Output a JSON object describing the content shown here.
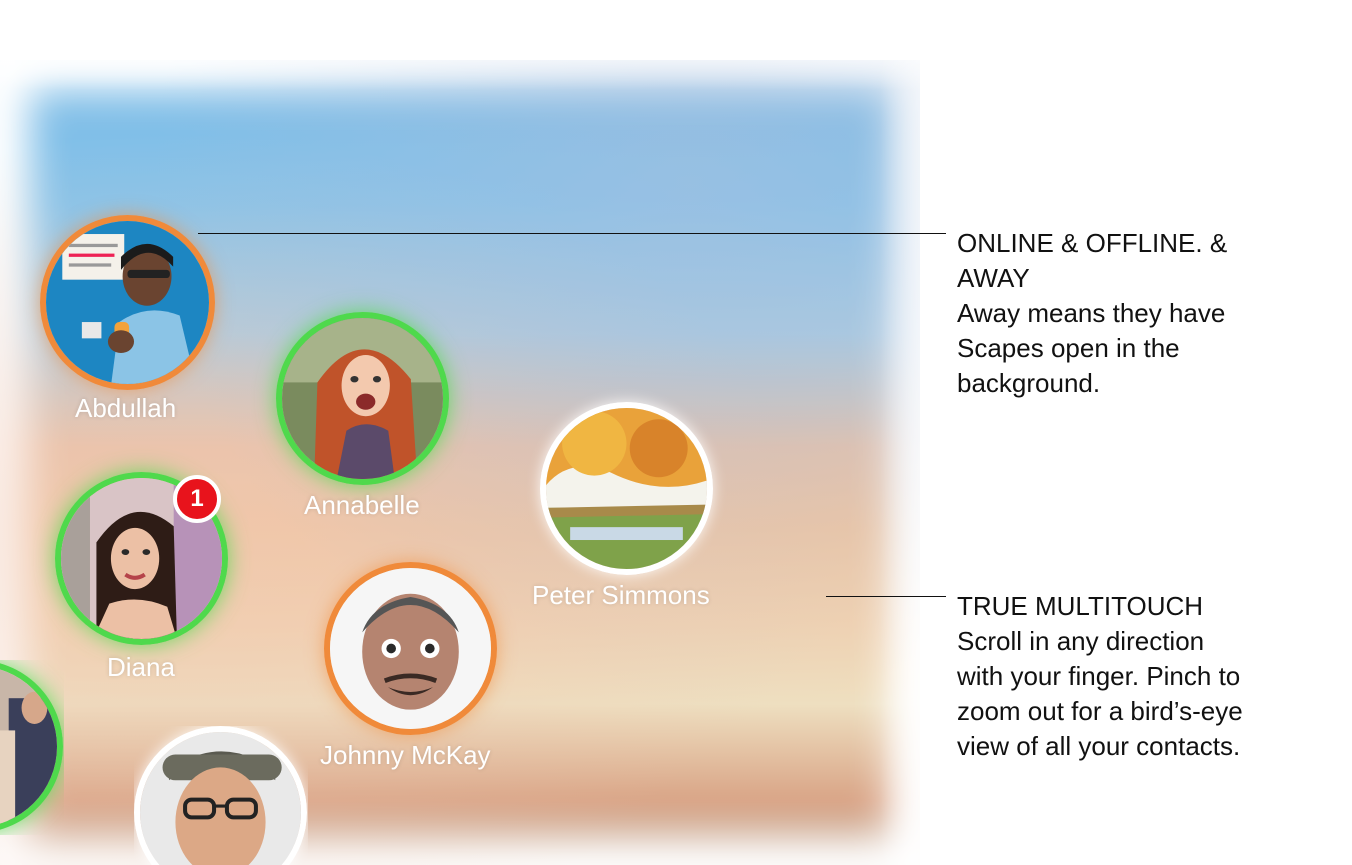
{
  "contacts": {
    "abdullah": {
      "name": "Abdullah",
      "status": "away"
    },
    "annabelle": {
      "name": "Annabelle",
      "status": "online"
    },
    "diana": {
      "name": "Diana",
      "status": "online",
      "unread": "1"
    },
    "peter": {
      "name": "Peter Simmons",
      "status": "offline"
    },
    "johnny": {
      "name": "Johnny McKay",
      "status": "away"
    }
  },
  "notes": {
    "status": {
      "title": "ONLINE & OFFLINE. & AWAY",
      "body": "Away means they have Scapes open in the background."
    },
    "multitouch": {
      "title": "TRUE MULTITOUCH",
      "body": "Scroll in any direction with your finger. Pinch to zoom out for a bird’s-eye view of all your contacts."
    }
  },
  "colors": {
    "away": "#f08a3a",
    "online": "#4fd94c",
    "offline": "#ffffff",
    "badge": "#e8131c"
  }
}
